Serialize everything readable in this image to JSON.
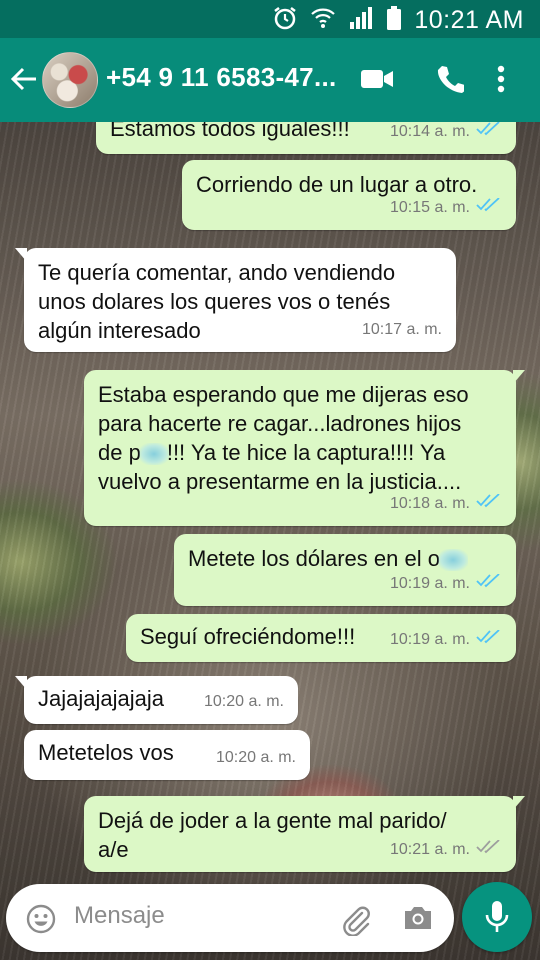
{
  "status_bar": {
    "time": "10:21 AM"
  },
  "header": {
    "contact": "+54 9 11 6583-47..."
  },
  "messages": [
    {
      "dir": "out",
      "text": "Estamos todos iguales!!!",
      "time": "10:14 a. m."
    },
    {
      "dir": "out",
      "text": "Corriendo de un lugar a otro.",
      "time": "10:15 a. m."
    },
    {
      "dir": "in",
      "lines": [
        "Te quería comentar, ando vendiendo",
        "unos dolares los queres vos o tenés",
        "algún interesado"
      ],
      "time": "10:17 a. m."
    },
    {
      "dir": "out",
      "lines": [
        "Estaba esperando que me dijeras eso",
        "para hacerte re cagar...ladrones hijos",
        "de p",
        "!!! Ya te hice la captura!!!! Ya",
        "vuelvo a presentarme en la justicia...."
      ],
      "time": "10:18 a. m."
    },
    {
      "dir": "out",
      "text": "Metete los dólares en el o",
      "time": "10:19 a. m."
    },
    {
      "dir": "out",
      "text": "Seguí ofreciéndome!!!",
      "time": "10:19 a. m."
    },
    {
      "dir": "in",
      "text": "Jajajajajajaja",
      "time": "10:20 a. m."
    },
    {
      "dir": "in",
      "text": "Metetelos vos",
      "time": "10:20 a. m."
    },
    {
      "dir": "out",
      "lines": [
        "Dejá de joder a la gente mal parido/",
        "a/e"
      ],
      "time": "10:21 a. m."
    }
  ],
  "input": {
    "placeholder": "Mensaje"
  },
  "colors": {
    "status_bar": "#056e5f",
    "app_bar": "#078c7a",
    "outgoing_bubble": "#dcf8c6",
    "incoming_bubble": "#ffffff",
    "ticks": "#4fc3f7",
    "mic_button": "#06937f"
  }
}
